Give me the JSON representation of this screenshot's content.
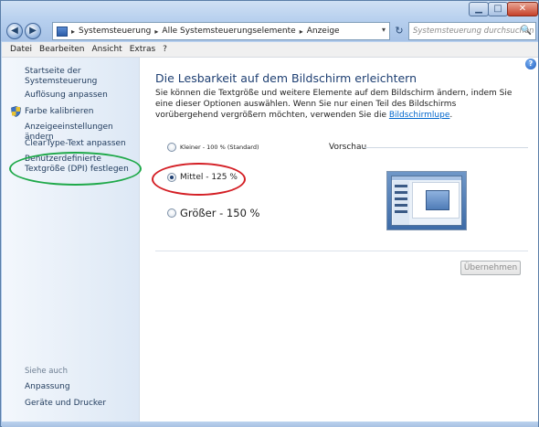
{
  "window": {
    "controls": {
      "minimize": "▁",
      "maximize": "□",
      "close": "✕"
    }
  },
  "nav": {
    "back": "◀",
    "forward": "▶",
    "dropdown": "▾"
  },
  "address": {
    "segments": [
      "Systemsteuerung",
      "Alle Systemsteuerungselemente",
      "Anzeige"
    ],
    "separator": "▸",
    "refresh": "↻"
  },
  "search": {
    "placeholder": "Systemsteuerung durchsuchen",
    "icon": "🔍"
  },
  "menu": [
    "Datei",
    "Bearbeiten",
    "Ansicht",
    "Extras",
    "?"
  ],
  "sidebar": {
    "home": "Startseite der Systemsteuerung",
    "links": [
      "Auflösung anpassen",
      "Farbe kalibrieren",
      "Anzeigeeinstellungen ändern",
      "ClearType-Text anpassen",
      "Benutzerdefinierte Textgröße (DPI) festlegen"
    ],
    "see_also_title": "Siehe auch",
    "see_also": [
      "Anpassung",
      "Geräte und Drucker"
    ]
  },
  "main": {
    "help": "?",
    "title": "Die Lesbarkeit auf dem Bildschirm erleichtern",
    "description_text": "Sie können die Textgröße und weitere Elemente auf dem Bildschirm ändern, indem Sie eine dieser Optionen auswählen. Wenn Sie nur einen Teil des Bildschirms vorübergehend vergrößern möchten, verwenden Sie die",
    "description_link": "Bildschirmlupe",
    "description_end": ".",
    "options": [
      {
        "label": "Kleiner - 100 % (Standard)",
        "selected": false
      },
      {
        "label": "Mittel - 125 %",
        "selected": true
      },
      {
        "label": "Größer - 150 %",
        "selected": false
      }
    ],
    "preview_label": "Vorschau",
    "apply_button": "Übernehmen"
  },
  "annotations": {
    "green_color": "#1fa94a",
    "red_color": "#d41f25"
  }
}
